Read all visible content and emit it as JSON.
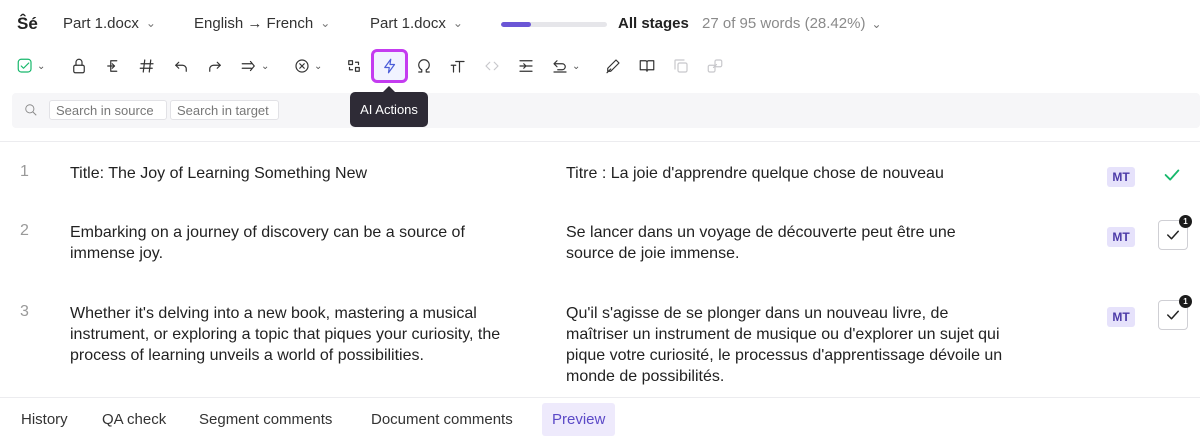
{
  "topbar": {
    "logo": "Ŝé",
    "file_menu": "Part 1.docx",
    "language_pair": "English → French",
    "document_menu": "Part 1.docx",
    "progress_fraction": 0.2842,
    "stage_label": "All stages",
    "word_count": "27 of 95 words",
    "word_percent": "(28.42%)"
  },
  "toolbar": {
    "tooltip": "AI Actions",
    "items": [
      "confirm-icon",
      "lock-icon",
      "copy-source-icon",
      "tag-icon",
      "undo-icon",
      "redo-icon",
      "join-icon",
      "clear-icon",
      "convert-icon",
      "ai-actions-icon",
      "special-chars-icon",
      "text-case-icon",
      "code-icon",
      "split-icon",
      "revert-icon",
      "edit-icon",
      "dictionary-icon",
      "duplicate-icon",
      "link-icon"
    ]
  },
  "search": {
    "source_placeholder": "Search in source",
    "target_placeholder": "Search in target"
  },
  "segments": [
    {
      "number": "1",
      "source": "Title: The Joy of Learning Something New",
      "target": "Titre : La joie d'apprendre quelque chose de nouveau",
      "origin": "MT",
      "status": "confirmed"
    },
    {
      "number": "2",
      "source": "Embarking on a journey of discovery can be a source of immense joy.",
      "target": "Se lancer dans un voyage de découverte peut être une source de joie immense.",
      "origin": "MT",
      "status": "unconfirmed",
      "badge": "1"
    },
    {
      "number": "3",
      "source": "Whether it's delving into a new book, mastering a musical instrument, or exploring a topic that piques your curiosity, the process of learning unveils a world of possibilities.",
      "target": "Qu'il s'agisse de se plonger dans un nouveau livre, de maîtriser un instrument de musique ou d'explorer un sujet qui pique votre curiosité, le processus d'apprentissage dévoile un monde de possibilités.",
      "origin": "MT",
      "status": "unconfirmed",
      "badge": "1"
    }
  ],
  "bottom_tabs": [
    "History",
    "QA check",
    "Segment comments",
    "Document comments",
    "Preview"
  ],
  "active_tab": "Preview",
  "colors": {
    "accent": "#6b56d6",
    "confirmed_green": "#17b86c",
    "highlight": "#c43cf0",
    "mt_badge_bg": "#e6e2fb"
  }
}
